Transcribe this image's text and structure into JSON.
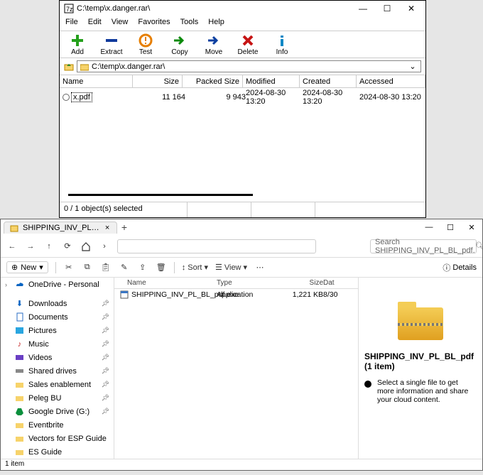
{
  "sevenzip": {
    "title": "C:\\temp\\x.danger.rar\\",
    "menus": {
      "file": "File",
      "edit": "Edit",
      "view": "View",
      "favorites": "Favorites",
      "tools": "Tools",
      "help": "Help"
    },
    "tools": {
      "add": "Add",
      "extract": "Extract",
      "test": "Test",
      "copy": "Copy",
      "move": "Move",
      "delete": "Delete",
      "info": "Info"
    },
    "addr": "C:\\temp\\x.danger.rar\\",
    "headers": {
      "name": "Name",
      "size": "Size",
      "psize": "Packed Size",
      "modified": "Modified",
      "created": "Created",
      "accessed": "Accessed"
    },
    "row": {
      "name": "x.pdf",
      "size": "11 164",
      "psize": "9 943",
      "modified": "2024-08-30 13:20",
      "created": "2024-08-30 13:20",
      "accessed": "2024-08-30 13:20"
    },
    "status": "0 / 1 object(s) selected"
  },
  "explorer": {
    "tab": "SHIPPING_INV_PL_BL_pdf.rar",
    "search_placeholder": "Search SHIPPING_INV_PL_BL_pdf.",
    "toolbar": {
      "new": "New",
      "sort": "Sort",
      "view": "View",
      "details": "Details"
    },
    "headers": {
      "name": "Name",
      "type": "Type",
      "size": "Size",
      "date": "Dat"
    },
    "row": {
      "name": "SHIPPING_INV_PL_BL_pdf.exe",
      "type": "Application",
      "size": "1,221 KB",
      "date": "8/30"
    },
    "sidebar": {
      "onedrive": "OneDrive - Personal",
      "downloads": "Downloads",
      "documents": "Documents",
      "pictures": "Pictures",
      "music": "Music",
      "videos": "Videos",
      "shared": "Shared drives",
      "sales": "Sales enablement",
      "peleg": "Peleg BU",
      "gdrive": "Google Drive (G:)",
      "eventbrite": "Eventbrite",
      "vectors": "Vectors for ESP Guide",
      "es": "ES Guide"
    },
    "preview": {
      "title": "SHIPPING_INV_PL_BL_pdf (1 item)",
      "msg": "Select a single file to get more information and share your cloud content."
    },
    "status": "1 item"
  }
}
